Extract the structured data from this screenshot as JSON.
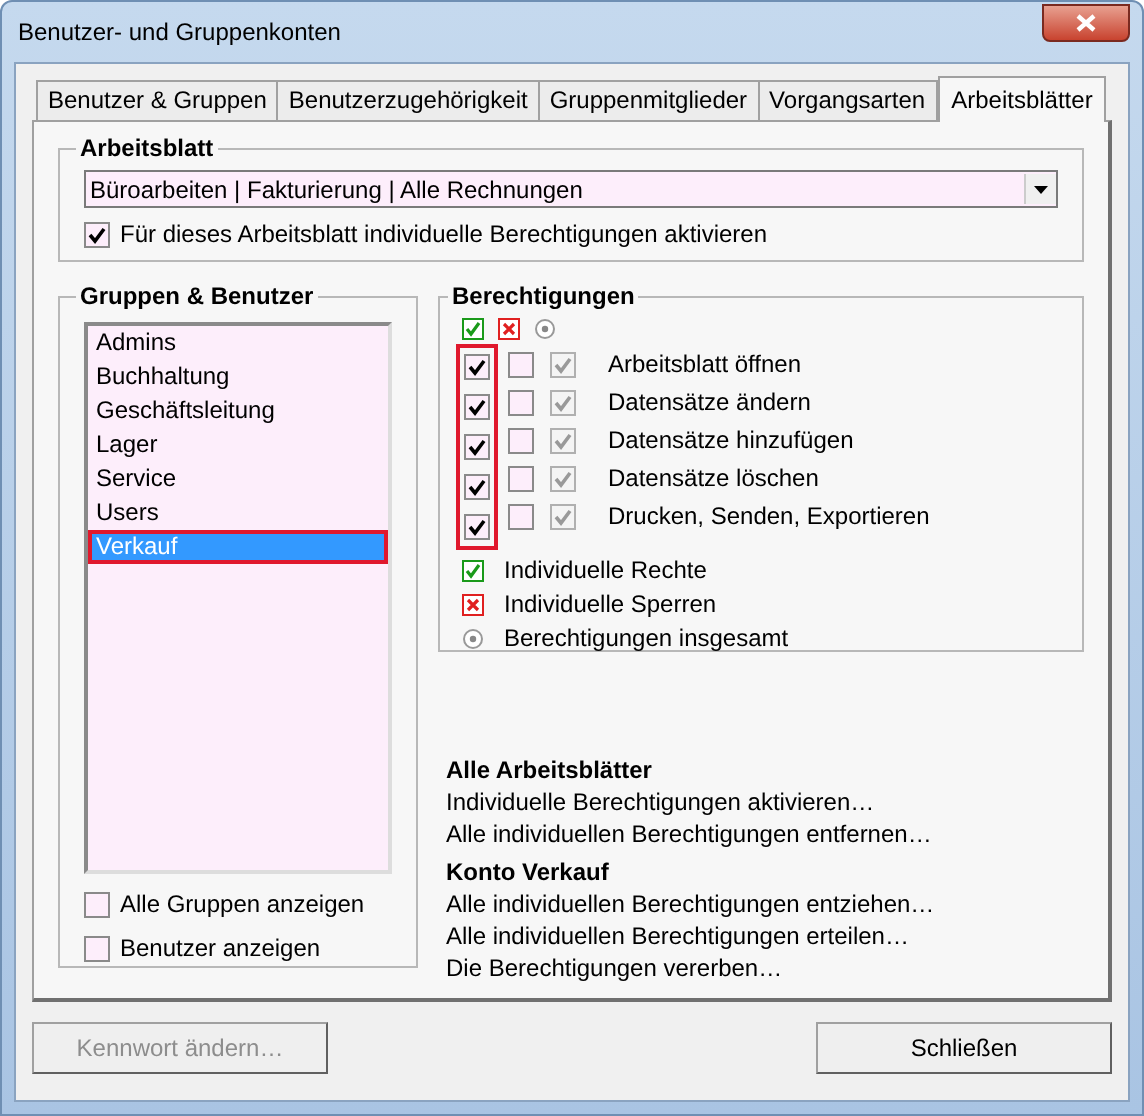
{
  "window": {
    "title": "Benutzer- und Gruppenkonten"
  },
  "tabs": [
    {
      "label": "Benutzer & Gruppen",
      "selected": false
    },
    {
      "label": "Benutzerzugehörigkeit",
      "selected": false
    },
    {
      "label": "Gruppenmitglieder",
      "selected": false
    },
    {
      "label": "Vorgangsarten",
      "selected": false
    },
    {
      "label": "Arbeitsblätter",
      "selected": true
    }
  ],
  "worksheet": {
    "title": "Arbeitsblatt",
    "value": "Büroarbeiten | Fakturierung | Alle Rechnungen",
    "checkbox": {
      "label": "Für dieses Arbeitsblatt individuelle Berechtigungen aktivieren",
      "checked": true
    }
  },
  "groups": {
    "title": "Gruppen & Benutzer",
    "items": [
      {
        "label": "Admins",
        "selected": false,
        "highlighted": false
      },
      {
        "label": "Buchhaltung",
        "selected": false,
        "highlighted": false
      },
      {
        "label": "Geschäftsleitung",
        "selected": false,
        "highlighted": false
      },
      {
        "label": "Lager",
        "selected": false,
        "highlighted": false
      },
      {
        "label": "Service",
        "selected": false,
        "highlighted": false
      },
      {
        "label": "Users",
        "selected": false,
        "highlighted": false
      },
      {
        "label": "Verkauf",
        "selected": true,
        "highlighted": true
      }
    ],
    "options": [
      {
        "label": "Alle Gruppen anzeigen",
        "checked": false
      },
      {
        "label": "Benutzer anzeigen",
        "checked": false
      }
    ]
  },
  "permissions": {
    "title": "Berechtigungen",
    "highlight_first_column": true,
    "rows": [
      {
        "label": "Arbeitsblatt öffnen",
        "granted": true,
        "denied": false,
        "total": true
      },
      {
        "label": "Datensätze ändern",
        "granted": true,
        "denied": false,
        "total": true
      },
      {
        "label": "Datensätze hinzufügen",
        "granted": true,
        "denied": false,
        "total": true
      },
      {
        "label": "Datensätze löschen",
        "granted": true,
        "denied": false,
        "total": true
      },
      {
        "label": "Drucken, Senden, Exportieren",
        "granted": true,
        "denied": false,
        "total": true
      }
    ],
    "legend": [
      {
        "kind": "grant",
        "label": "Individuelle Rechte"
      },
      {
        "kind": "deny",
        "label": "Individuelle Sperren"
      },
      {
        "kind": "total",
        "label": "Berechtigungen insgesamt"
      }
    ]
  },
  "actions": [
    {
      "heading": "Alle Arbeitsblätter",
      "links": [
        "Individuelle Berechtigungen aktivieren…",
        "Alle individuellen Berechtigungen entfernen…"
      ]
    },
    {
      "heading": "Konto Verkauf",
      "links": [
        "Alle individuellen Berechtigungen entziehen…",
        "Alle individuellen Berechtigungen erteilen…",
        "Die Berechtigungen vererben…"
      ]
    }
  ],
  "buttons": [
    {
      "label": "Kennwort ändern…",
      "disabled": true
    },
    {
      "label": "Schließen",
      "disabled": false
    }
  ]
}
